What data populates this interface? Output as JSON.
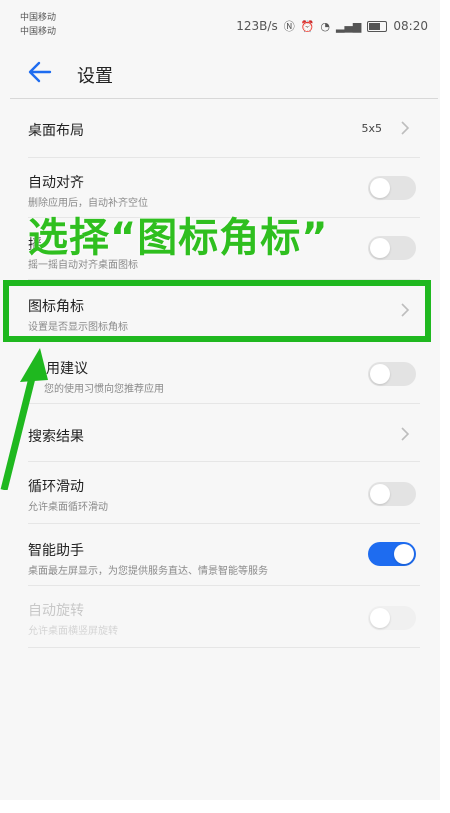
{
  "status_bar": {
    "carrier_1": "中国移动",
    "carrier_2": "中国移动",
    "speed": "123B/s",
    "time": "08:20"
  },
  "header": {
    "title": "设置",
    "back_icon": "arrow-left-icon"
  },
  "settings": [
    {
      "title": "桌面布局",
      "value": "5x5",
      "control": "chevron"
    },
    {
      "title": "自动对齐",
      "subtitle": "删除应用后，自动补齐空位",
      "control": "toggle",
      "on": false
    },
    {
      "title": "摇",
      "subtitle": "摇一摇自动对齐桌面图标",
      "control": "toggle",
      "on": false
    },
    {
      "title": "图标角标",
      "subtitle": "设置是否显示图标角标",
      "control": "chevron"
    },
    {
      "title": "用建议",
      "subtitle": "您的使用习惯向您推荐应用",
      "control": "toggle",
      "on": false
    },
    {
      "title": "搜索结果",
      "control": "chevron"
    },
    {
      "title": "循环滑动",
      "subtitle": "允许桌面循环滑动",
      "control": "toggle",
      "on": false
    },
    {
      "title": "智能助手",
      "subtitle": "桌面最左屏显示，为您提供服务直达、情景智能等服务",
      "control": "toggle",
      "on": true
    },
    {
      "title": "自动旋转",
      "subtitle": "允许桌面横竖屏旋转",
      "control": "toggle",
      "on": false,
      "disabled": true
    }
  ],
  "overlay": {
    "caption": "选择“图标角标”",
    "color": "#2fbf1f"
  },
  "colors": {
    "toggle_on": "#1e6cf0",
    "accent_back": "#1e6cf0"
  }
}
